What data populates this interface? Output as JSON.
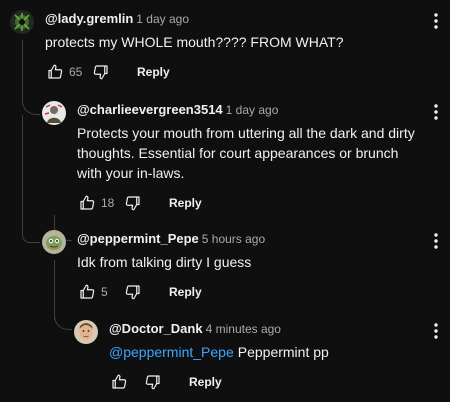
{
  "comments": [
    {
      "author": "@lady.gremlin",
      "time": "1 day ago",
      "text": "protects my WHOLE mouth???? FROM WHAT?",
      "likes": "65",
      "reply": "Reply"
    },
    {
      "author": "@charlieevergreen3514",
      "time": "1 day ago",
      "text": "Protects your mouth from uttering all the dark and dirty thoughts. Essential for court appearances or brunch with your in-laws.",
      "likes": "18",
      "reply": "Reply"
    },
    {
      "author": "@peppermint_Pepe",
      "time": "5 hours ago",
      "text": "Idk from talking dirty I guess",
      "likes": "5",
      "reply": "Reply"
    },
    {
      "author": "@Doctor_Dank",
      "time": "4 minutes ago",
      "mention": "@peppermint_Pepe",
      "text": "Peppermint pp",
      "likes": "",
      "reply": "Reply"
    }
  ],
  "colors": {
    "background": "#0f0f0f",
    "text": "#f1f1f1",
    "secondary": "#aaaaaa",
    "mention": "#3ea6ff"
  }
}
